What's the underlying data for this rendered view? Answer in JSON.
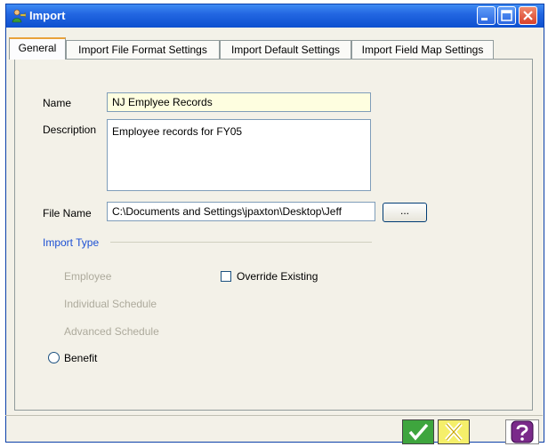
{
  "window": {
    "title": "Import",
    "icon": "import-person-icon"
  },
  "tabs": [
    {
      "label": "General"
    },
    {
      "label": "Import File Format Settings"
    },
    {
      "label": "Import Default Settings"
    },
    {
      "label": "Import Field Map Settings"
    }
  ],
  "form": {
    "name_label": "Name",
    "name_value": "NJ Emplyee Records",
    "description_label": "Description",
    "description_value": "Employee records for FY05",
    "filename_label": "File Name",
    "filename_value": "C:\\Documents and Settings\\jpaxton\\Desktop\\Jeff",
    "browse_label": "..."
  },
  "import_type": {
    "label": "Import Type",
    "options": [
      {
        "label": "Employee"
      },
      {
        "label": "Individual Schedule"
      },
      {
        "label": "Advanced Schedule"
      },
      {
        "label": "Benefit"
      }
    ],
    "override_label": "Override Existing"
  },
  "buttons": {
    "ok_icon": "checkmark-icon",
    "cancel_icon": "x-icon",
    "help_icon": "question-icon"
  },
  "colors": {
    "titlebar": "#2367e2",
    "group_label": "#1c50d4",
    "active_tab_accent": "#e9a23a"
  }
}
